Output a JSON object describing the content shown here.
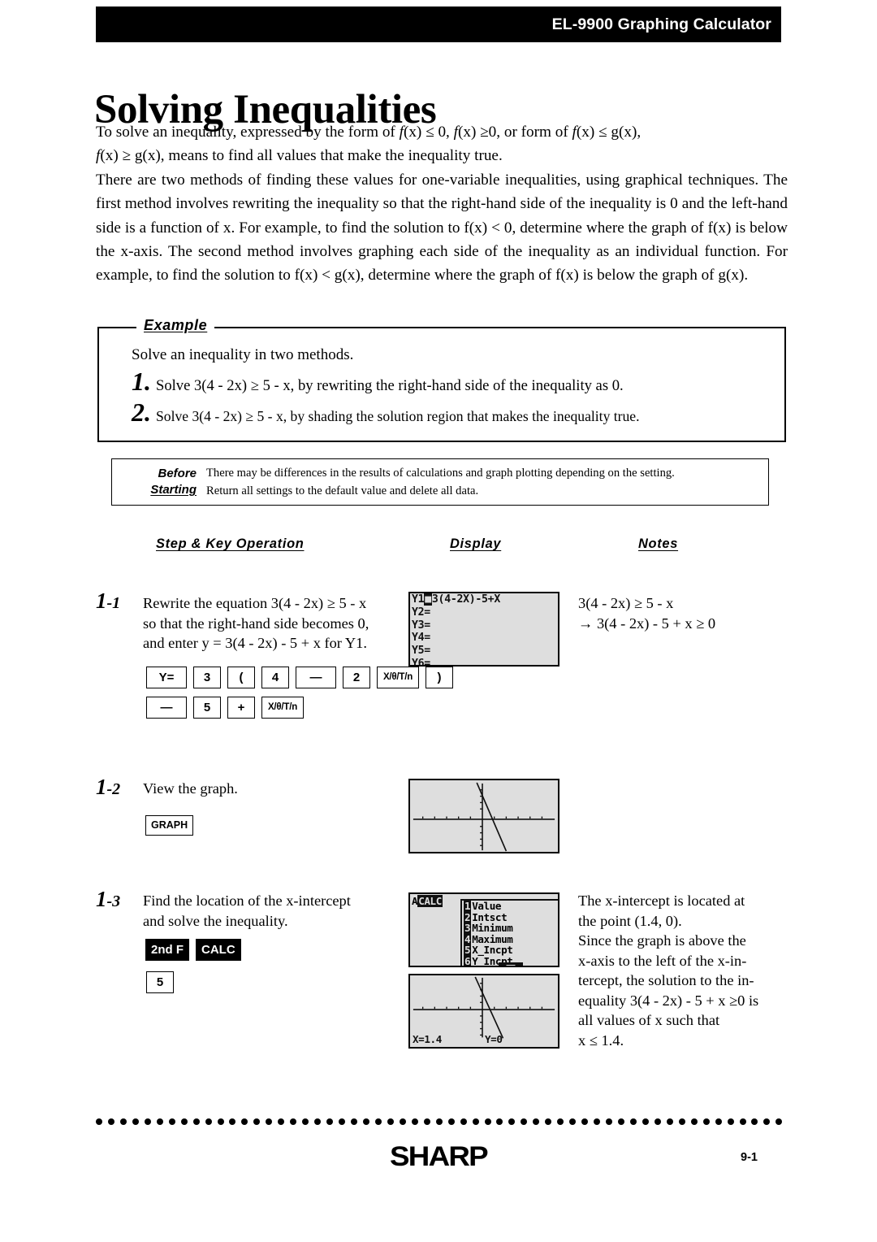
{
  "header": {
    "title": "EL-9900 Graphing Calculator"
  },
  "page_title": "Solving Inequalities",
  "intro": {
    "para1_part1": "To solve an inequality, expressed by the form of ",
    "para1_fx1": "f",
    "para1_seg1": "(x) ≤ 0,  ",
    "para1_fx2": "f",
    "para1_seg2": "(x) ≥0, or form of ",
    "para1_fx3": "f",
    "para1_seg3": "(x) ≤ g(x),",
    "para1_line2_fx": "f",
    "para1_line2": "(x) ≥ g(x), means to find all values that make the inequality true.",
    "para2": "There are two methods of finding these values for one-variable inequalities, using graphical techniques. The first method involves rewriting the inequality so that the right-hand side of the inequality is 0 and the left-hand side is a function of x. For example, to find the solution to f(x) < 0, determine where the graph of f(x) is below the x-axis. The second method involves graphing each side of the inequality as an individual function. For example, to find the solution to f(x) < g(x), determine where the graph of f(x) is below the graph of g(x)."
  },
  "example": {
    "label": "Example",
    "intro": "Solve an inequality in two methods.",
    "items": [
      {
        "num": "1.",
        "text": "Solve 3(4 - 2x) ≥ 5 - x, by rewriting the right-hand side of the inequality as 0."
      },
      {
        "num": "2.",
        "text": "Solve 3(4 - 2x) ≥ 5 - x, by shading the solution region that makes the inequality true."
      }
    ]
  },
  "before_starting": {
    "label_line1": "Before",
    "label_line2": "Starting",
    "line1": "There may be differences in the results of calculations and graph plotting depending on the setting.",
    "line2": "Return all settings to the default value and delete all data."
  },
  "columns": {
    "step": "Step & Key Operation",
    "display": "Display",
    "notes": "Notes"
  },
  "steps": [
    {
      "num": "1",
      "sub": "-1",
      "text_line1": "Rewrite the equation 3(4 - 2x) ≥ 5 - x",
      "text_line2": "so that the right-hand side becomes 0,",
      "text_line3": "and enter y = 3(4 - 2x) - 5 + x  for Y1.",
      "keys_row1": [
        "Y=",
        "3",
        "(",
        "4",
        "—",
        "2",
        "X/θ/T/n",
        ")"
      ],
      "keys_row2": [
        "—",
        "5",
        "+",
        "X/θ/T/n"
      ],
      "notes_line1": "3(4 - 2x) ≥ 5 - x",
      "notes_line2": "→ 3(4 - 2x) - 5 + x ≥ 0"
    },
    {
      "num": "1",
      "sub": "-2",
      "text_line1": "View the graph.",
      "keys_row1": [
        "GRAPH"
      ]
    },
    {
      "num": "1",
      "sub": "-3",
      "text_line1": "Find the location of the x-intercept",
      "text_line2": "and solve the inequality.",
      "keys_row1": [
        "2nd F",
        "CALC"
      ],
      "keys_row2": [
        "5"
      ],
      "notes_line1": "The x-intercept is located at",
      "notes_line2": "the point (1.4, 0).",
      "notes_line3": "Since the graph is above the",
      "notes_line4": "x-axis to the left of the x-in-",
      "notes_line5": "tercept, the solution to the in-",
      "notes_line6": "equality  3(4 - 2x) - 5 + x ≥0 is",
      "notes_line7": "all values of x such that",
      "notes_line8": "x ≤ 1.4."
    }
  ],
  "displays": {
    "equation_editor": {
      "rows": [
        {
          "label": "Y1",
          "eq_marker": "■",
          "body": "3(4-2X)-5+X"
        },
        {
          "label": "Y2=",
          "eq_marker": "",
          "body": ""
        },
        {
          "label": "Y3=",
          "eq_marker": "",
          "body": ""
        },
        {
          "label": "Y4=",
          "eq_marker": "",
          "body": ""
        },
        {
          "label": "Y5=",
          "eq_marker": "",
          "body": ""
        },
        {
          "label": "Y6=",
          "eq_marker": "",
          "body": ""
        }
      ]
    },
    "calc_menu": {
      "title_a": "A",
      "title_name": "CALC",
      "items": [
        {
          "key": "1",
          "label": "Value"
        },
        {
          "key": "2",
          "label": "Intsct"
        },
        {
          "key": "3",
          "label": "Minimum"
        },
        {
          "key": "4",
          "label": "Maximum"
        },
        {
          "key": "5",
          "label": "X_Incpt"
        },
        {
          "key": "6",
          "label": "Y_Incpt"
        }
      ]
    },
    "graph_result": {
      "x_readout": "X=1.4",
      "y_readout": "Y=0"
    }
  },
  "footer": {
    "brand": "SHARP",
    "page_number": "9-1"
  },
  "colors": {
    "header_bg": "#000000",
    "header_text": "#ffffff",
    "screen_bg": "#dedede",
    "screen_ink": "#111111"
  }
}
